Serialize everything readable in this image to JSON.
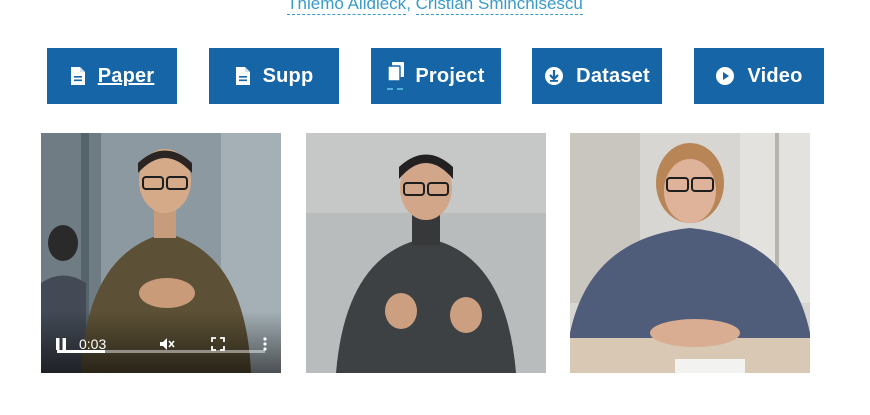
{
  "authors": [
    "Thiemo Alldieck",
    "Cristian Sminchisescu"
  ],
  "author_separator": ", ",
  "buttons": [
    {
      "label": "Paper",
      "icon": "document-icon"
    },
    {
      "label": "Supp",
      "icon": "document-icon"
    },
    {
      "label": "Project",
      "icon": "copy-icon"
    },
    {
      "label": "Dataset",
      "icon": "download-circle-icon"
    },
    {
      "label": "Video",
      "icon": "play-circle-icon"
    }
  ],
  "colors": {
    "button_bg": "#1565a7",
    "link": "#3a9ac9"
  },
  "video": {
    "time": "0:03",
    "progress": 0.23
  }
}
